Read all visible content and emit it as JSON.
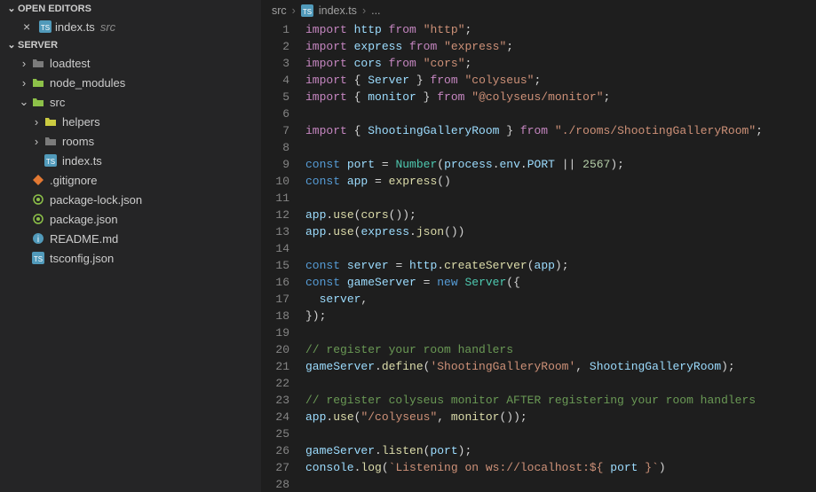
{
  "sidebar": {
    "openEditors": {
      "title": "OPEN EDITORS",
      "items": [
        {
          "name": "index.ts",
          "hint": "src"
        }
      ]
    },
    "explorer": {
      "title": "SERVER",
      "tree": [
        {
          "depth": 1,
          "chev": "›",
          "icon": "folder",
          "color": "#7b7b7b",
          "label": "loadtest"
        },
        {
          "depth": 1,
          "chev": "›",
          "icon": "folder-node",
          "color": "#8dc149",
          "label": "node_modules"
        },
        {
          "depth": 1,
          "chev": "⌄",
          "icon": "folder-src",
          "color": "#8dc149",
          "label": "src"
        },
        {
          "depth": 2,
          "chev": "›",
          "icon": "folder-helpers",
          "color": "#cbcb41",
          "label": "helpers"
        },
        {
          "depth": 2,
          "chev": "›",
          "icon": "folder",
          "color": "#7b7b7b",
          "label": "rooms"
        },
        {
          "depth": 2,
          "chev": "",
          "icon": "ts",
          "color": "#519aba",
          "label": "index.ts"
        },
        {
          "depth": 1,
          "chev": "",
          "icon": "git",
          "color": "#e37933",
          "label": ".gitignore"
        },
        {
          "depth": 1,
          "chev": "",
          "icon": "npm",
          "color": "#8dc149",
          "label": "package-lock.json"
        },
        {
          "depth": 1,
          "chev": "",
          "icon": "npm",
          "color": "#8dc149",
          "label": "package.json"
        },
        {
          "depth": 1,
          "chev": "",
          "icon": "info",
          "color": "#519aba",
          "label": "README.md"
        },
        {
          "depth": 1,
          "chev": "",
          "icon": "ts",
          "color": "#519aba",
          "label": "tsconfig.json"
        }
      ]
    }
  },
  "breadcrumb": {
    "parts": [
      "src",
      "index.ts",
      "..."
    ]
  },
  "code": {
    "lines": [
      [
        [
          "kw",
          "import"
        ],
        [
          "punc",
          " "
        ],
        [
          "var",
          "http"
        ],
        [
          "punc",
          " "
        ],
        [
          "kw",
          "from"
        ],
        [
          "punc",
          " "
        ],
        [
          "str",
          "\"http\""
        ],
        [
          "punc",
          ";"
        ]
      ],
      [
        [
          "kw",
          "import"
        ],
        [
          "punc",
          " "
        ],
        [
          "var",
          "express"
        ],
        [
          "punc",
          " "
        ],
        [
          "kw",
          "from"
        ],
        [
          "punc",
          " "
        ],
        [
          "str",
          "\"express\""
        ],
        [
          "punc",
          ";"
        ]
      ],
      [
        [
          "kw",
          "import"
        ],
        [
          "punc",
          " "
        ],
        [
          "var",
          "cors"
        ],
        [
          "punc",
          " "
        ],
        [
          "kw",
          "from"
        ],
        [
          "punc",
          " "
        ],
        [
          "str",
          "\"cors\""
        ],
        [
          "punc",
          ";"
        ]
      ],
      [
        [
          "kw",
          "import"
        ],
        [
          "punc",
          " { "
        ],
        [
          "var",
          "Server"
        ],
        [
          "punc",
          " } "
        ],
        [
          "kw",
          "from"
        ],
        [
          "punc",
          " "
        ],
        [
          "str",
          "\"colyseus\""
        ],
        [
          "punc",
          ";"
        ]
      ],
      [
        [
          "kw",
          "import"
        ],
        [
          "punc",
          " { "
        ],
        [
          "var",
          "monitor"
        ],
        [
          "punc",
          " } "
        ],
        [
          "kw",
          "from"
        ],
        [
          "punc",
          " "
        ],
        [
          "str",
          "\"@colyseus/monitor\""
        ],
        [
          "punc",
          ";"
        ]
      ],
      [],
      [
        [
          "kw",
          "import"
        ],
        [
          "punc",
          " { "
        ],
        [
          "var",
          "ShootingGalleryRoom"
        ],
        [
          "punc",
          " } "
        ],
        [
          "kw",
          "from"
        ],
        [
          "punc",
          " "
        ],
        [
          "str",
          "\"./rooms/ShootingGalleryRoom\""
        ],
        [
          "punc",
          ";"
        ]
      ],
      [],
      [
        [
          "const",
          "const"
        ],
        [
          "punc",
          " "
        ],
        [
          "var",
          "port"
        ],
        [
          "punc",
          " = "
        ],
        [
          "type",
          "Number"
        ],
        [
          "punc",
          "("
        ],
        [
          "var",
          "process"
        ],
        [
          "punc",
          "."
        ],
        [
          "var",
          "env"
        ],
        [
          "punc",
          "."
        ],
        [
          "var",
          "PORT"
        ],
        [
          "punc",
          " || "
        ],
        [
          "num",
          "2567"
        ],
        [
          "punc",
          ");"
        ]
      ],
      [
        [
          "const",
          "const"
        ],
        [
          "punc",
          " "
        ],
        [
          "var",
          "app"
        ],
        [
          "punc",
          " = "
        ],
        [
          "fn",
          "express"
        ],
        [
          "punc",
          "()"
        ]
      ],
      [],
      [
        [
          "var",
          "app"
        ],
        [
          "punc",
          "."
        ],
        [
          "fn",
          "use"
        ],
        [
          "punc",
          "("
        ],
        [
          "fn",
          "cors"
        ],
        [
          "punc",
          "());"
        ]
      ],
      [
        [
          "var",
          "app"
        ],
        [
          "punc",
          "."
        ],
        [
          "fn",
          "use"
        ],
        [
          "punc",
          "("
        ],
        [
          "var",
          "express"
        ],
        [
          "punc",
          "."
        ],
        [
          "fn",
          "json"
        ],
        [
          "punc",
          "())"
        ]
      ],
      [],
      [
        [
          "const",
          "const"
        ],
        [
          "punc",
          " "
        ],
        [
          "var",
          "server"
        ],
        [
          "punc",
          " = "
        ],
        [
          "var",
          "http"
        ],
        [
          "punc",
          "."
        ],
        [
          "fn",
          "createServer"
        ],
        [
          "punc",
          "("
        ],
        [
          "var",
          "app"
        ],
        [
          "punc",
          ");"
        ]
      ],
      [
        [
          "const",
          "const"
        ],
        [
          "punc",
          " "
        ],
        [
          "var",
          "gameServer"
        ],
        [
          "punc",
          " = "
        ],
        [
          "const",
          "new"
        ],
        [
          "punc",
          " "
        ],
        [
          "type",
          "Server"
        ],
        [
          "punc",
          "({"
        ]
      ],
      [
        [
          "punc",
          "  "
        ],
        [
          "var",
          "server"
        ],
        [
          "punc",
          ","
        ]
      ],
      [
        [
          "punc",
          "});"
        ]
      ],
      [],
      [
        [
          "comment",
          "// register your room handlers"
        ]
      ],
      [
        [
          "var",
          "gameServer"
        ],
        [
          "punc",
          "."
        ],
        [
          "fn",
          "define"
        ],
        [
          "punc",
          "("
        ],
        [
          "str",
          "'ShootingGalleryRoom'"
        ],
        [
          "punc",
          ", "
        ],
        [
          "var",
          "ShootingGalleryRoom"
        ],
        [
          "punc",
          ");"
        ]
      ],
      [],
      [
        [
          "comment",
          "// register colyseus monitor AFTER registering your room handlers"
        ]
      ],
      [
        [
          "var",
          "app"
        ],
        [
          "punc",
          "."
        ],
        [
          "fn",
          "use"
        ],
        [
          "punc",
          "("
        ],
        [
          "str",
          "\"/colyseus\""
        ],
        [
          "punc",
          ", "
        ],
        [
          "fn",
          "monitor"
        ],
        [
          "punc",
          "());"
        ]
      ],
      [],
      [
        [
          "var",
          "gameServer"
        ],
        [
          "punc",
          "."
        ],
        [
          "fn",
          "listen"
        ],
        [
          "punc",
          "("
        ],
        [
          "var",
          "port"
        ],
        [
          "punc",
          ");"
        ]
      ],
      [
        [
          "var",
          "console"
        ],
        [
          "punc",
          "."
        ],
        [
          "fn",
          "log"
        ],
        [
          "punc",
          "("
        ],
        [
          "str",
          "`Listening on ws://localhost:${ "
        ],
        [
          "var",
          "port"
        ],
        [
          "str",
          " }`"
        ],
        [
          "punc",
          ")"
        ]
      ],
      []
    ]
  }
}
